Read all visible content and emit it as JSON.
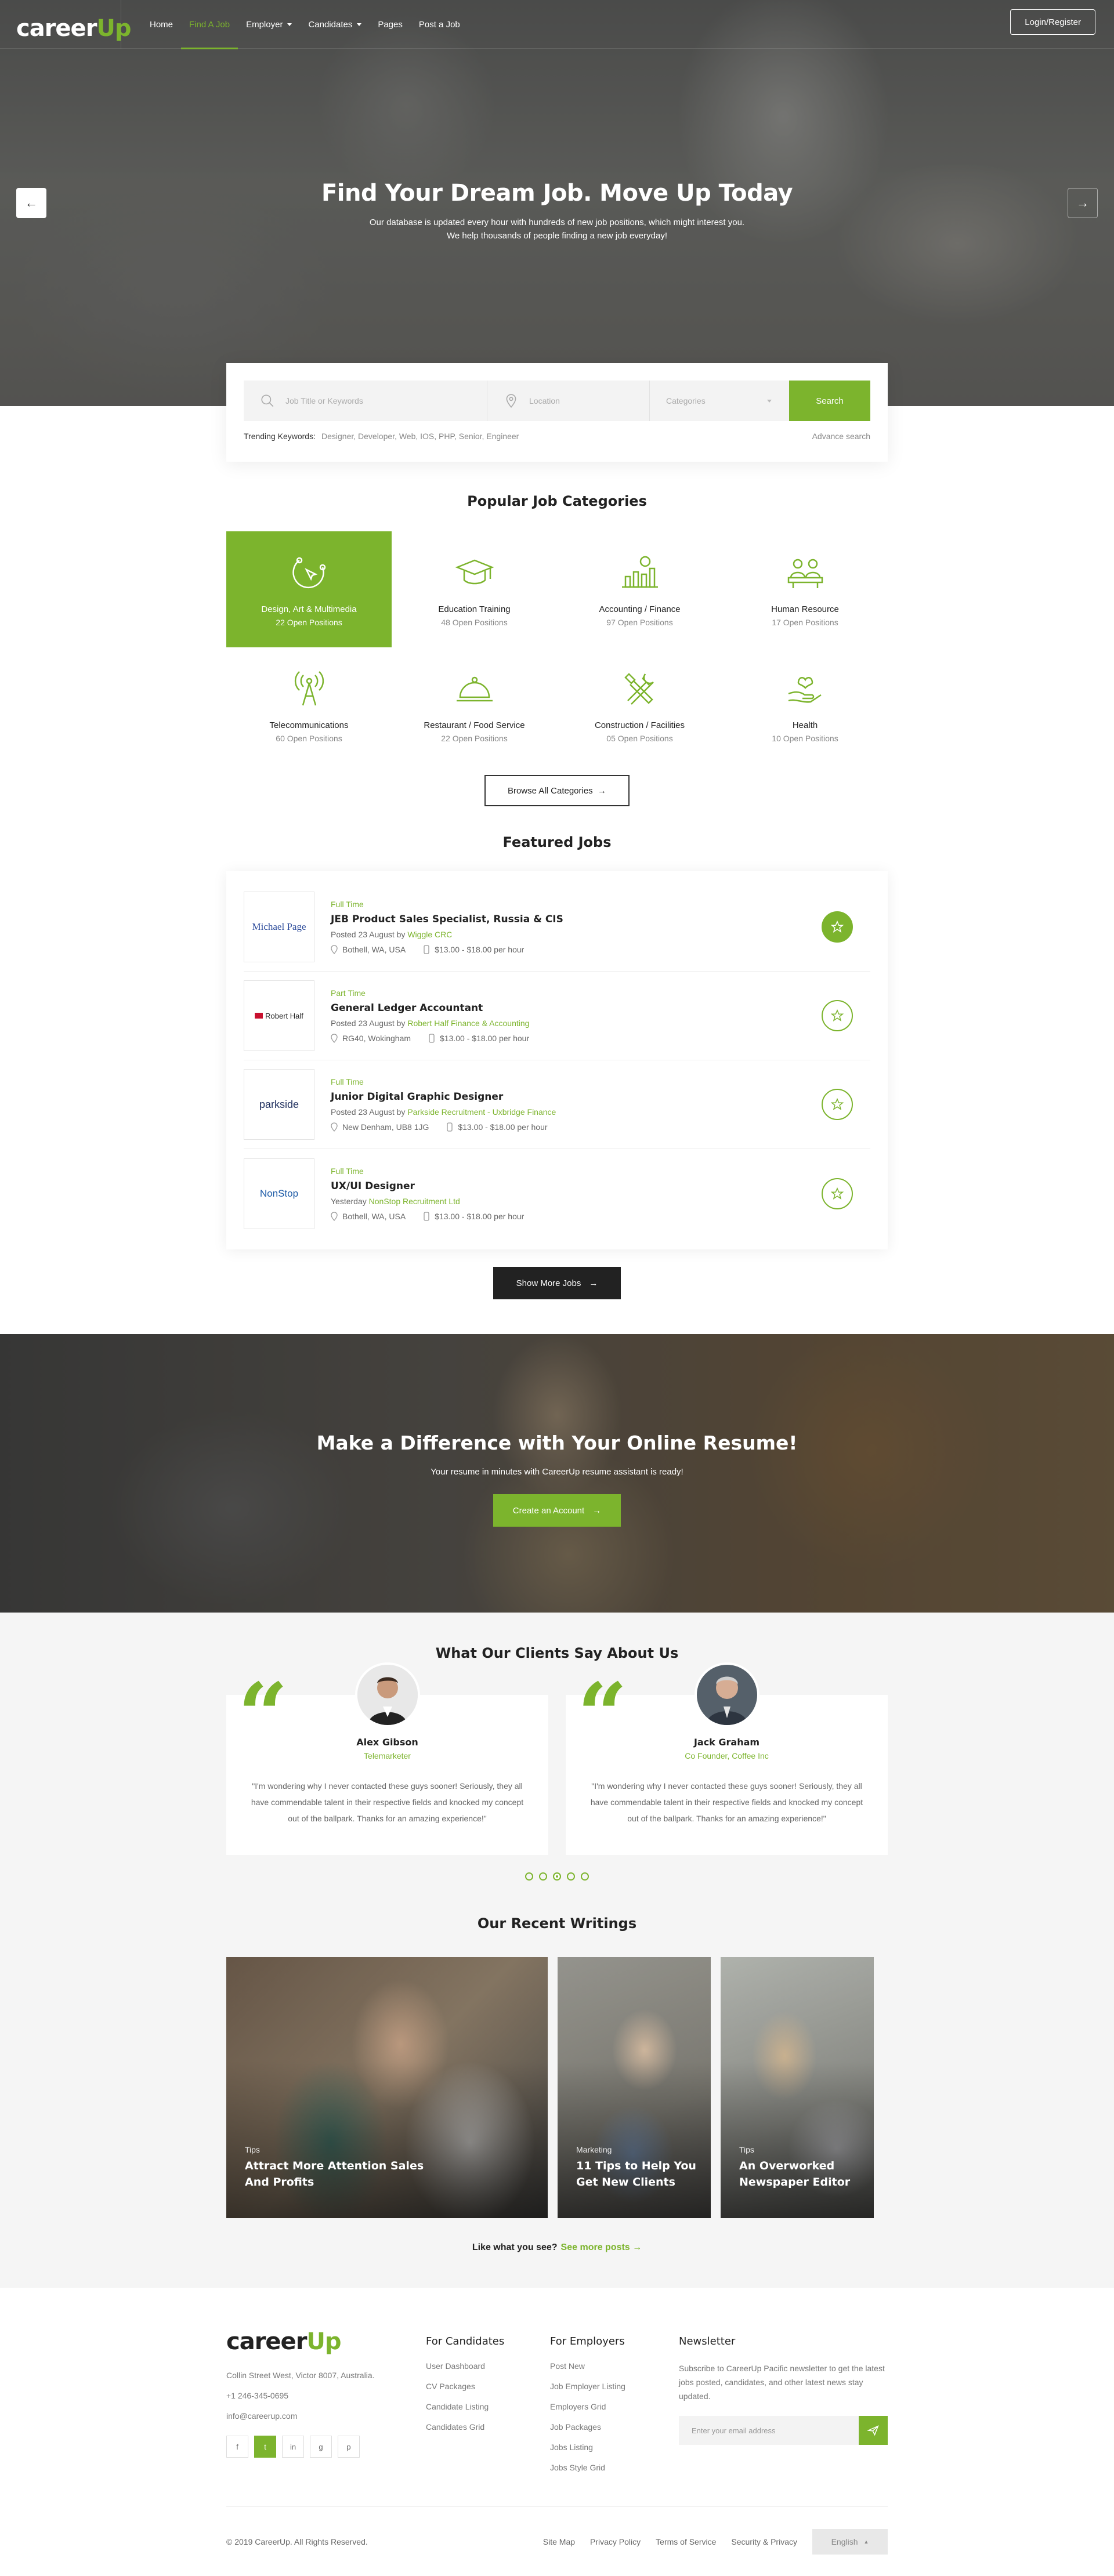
{
  "header": {
    "logo_main": "career",
    "logo_accent": "Up",
    "nav": [
      {
        "label": "Home"
      },
      {
        "label": "Find A Job"
      },
      {
        "label": "Employer"
      },
      {
        "label": "Candidates"
      },
      {
        "label": "Pages"
      },
      {
        "label": "Post a Job"
      }
    ],
    "login_label": "Login/Register"
  },
  "hero": {
    "title": "Find Your Dream Job. Move Up Today",
    "line1": "Our database is updated every hour with hundreds of new job positions, which might interest you.",
    "line2": "We help thousands of people finding a new job everyday!"
  },
  "search": {
    "keyword_placeholder": "Job Title or Keywords",
    "location_placeholder": "Location",
    "category_placeholder": "Categories",
    "button_label": "Search",
    "trending_label": "Trending Keywords:",
    "trending_values": "Designer,  Developer,  Web,  IOS,  PHP,  Senior,  Engineer",
    "advance_label": "Advance search"
  },
  "categories": {
    "title": "Popular Job Categories",
    "items": [
      {
        "name": "Design, Art & Multimedia",
        "count": "22 Open Positions",
        "icon": "design-icon"
      },
      {
        "name": "Education Training",
        "count": "48 Open Positions",
        "icon": "graduation-cap-icon"
      },
      {
        "name": "Accounting / Finance",
        "count": "97 Open Positions",
        "icon": "finance-chart-icon"
      },
      {
        "name": "Human Resource",
        "count": "17 Open Positions",
        "icon": "people-icon"
      },
      {
        "name": "Telecommunications",
        "count": "60 Open Positions",
        "icon": "antenna-icon"
      },
      {
        "name": "Restaurant / Food Service",
        "count": "22 Open Positions",
        "icon": "cloche-icon"
      },
      {
        "name": "Construction / Facilities",
        "count": "05 Open Positions",
        "icon": "tools-icon"
      },
      {
        "name": "Health",
        "count": "10 Open Positions",
        "icon": "health-hand-icon"
      }
    ],
    "browse_label": "Browse All Categories"
  },
  "featured": {
    "title": "Featured Jobs",
    "jobs": [
      {
        "type": "Full Time",
        "title": "JEB Product Sales Specialist, Russia & CIS",
        "posted": "Posted 23 August by",
        "company": "Wiggle CRC",
        "location": "Bothell, WA, USA",
        "salary": "$13.00 - $18.00 per hour",
        "logo": "Michael Page"
      },
      {
        "type": "Part Time",
        "title": "General Ledger Accountant",
        "posted": "Posted 23 August by",
        "company": "Robert Half Finance & Accounting",
        "location": "RG40, Wokingham",
        "salary": "$13.00 - $18.00 per hour",
        "logo": "Robert Half"
      },
      {
        "type": "Full Time",
        "title": "Junior Digital Graphic Designer",
        "posted": "Posted 23 August by",
        "company": "Parkside Recruitment - Uxbridge Finance",
        "location": "New Denham, UB8 1JG",
        "salary": "$13.00 - $18.00 per hour",
        "logo": "parkside"
      },
      {
        "type": "Full Time",
        "title": "UX/UI Designer",
        "posted": "Yesterday",
        "company": "NonStop Recruitment Ltd",
        "location": "Bothell, WA, USA",
        "salary": "$13.00 - $18.00 per hour",
        "logo": "NonStop"
      }
    ],
    "more_label": "Show More Jobs"
  },
  "cta": {
    "title": "Make a Difference with Your Online Resume!",
    "subtitle": "Your resume in minutes with CareerUp resume assistant is ready!",
    "button_label": "Create an Account"
  },
  "testimonials": {
    "title": "What Our Clients Say About Us",
    "items": [
      {
        "name": "Alex Gibson",
        "role": "Telemarketer",
        "text": "\"I'm wondering why I never contacted these guys sooner! Seriously, they all have commendable talent in their respective fields and knocked my concept out of the ballpark. Thanks for an amazing experience!\""
      },
      {
        "name": "Jack Graham",
        "role": "Co Founder, Coffee Inc",
        "text": "\"I'm wondering why I never contacted these guys sooner! Seriously, they all have commendable talent in their respective fields and knocked my concept out of the ballpark. Thanks for an amazing experience!\""
      }
    ],
    "active_dot": 2
  },
  "blog": {
    "title": "Our Recent Writings",
    "posts": [
      {
        "tag": "Tips",
        "title_line1": "Attract More Attention Sales",
        "title_line2": "And Profits"
      },
      {
        "tag": "Marketing",
        "title_line1": "11 Tips to Help You",
        "title_line2": "Get New Clients"
      },
      {
        "tag": "Tips",
        "title_line1": "An Overworked",
        "title_line2": "Newspaper Editor"
      }
    ],
    "more_prefix": "Like what you see?",
    "more_link": "See more posts"
  },
  "footer": {
    "logo_main": "career",
    "logo_accent": "Up",
    "address": "Collin Street West, Victor 8007, Australia.",
    "phone": "+1 246-345-0695",
    "email": "info@careerup.com",
    "socials": [
      "f",
      "t",
      "in",
      "g",
      "p"
    ],
    "candidates_title": "For Candidates",
    "candidates": [
      "User Dashboard",
      "CV Packages",
      "Candidate Listing",
      "Candidates Grid"
    ],
    "employers_title": "For Employers",
    "employers": [
      "Post New",
      "Job Employer Listing",
      "Employers Grid",
      "Job Packages",
      "Jobs Listing",
      "Jobs Style Grid"
    ],
    "newsletter_title": "Newsletter",
    "newsletter_text": "Subscribe to CareerUp Pacific newsletter to get the latest jobs posted, candidates, and other latest news stay updated.",
    "newsletter_placeholder": "Enter your email address",
    "copyright": "© 2019 CareerUp. All Rights Reserved.",
    "links": [
      "Site Map",
      "Privacy Policy",
      "Terms of Service",
      "Security & Privacy"
    ],
    "language": "English"
  }
}
